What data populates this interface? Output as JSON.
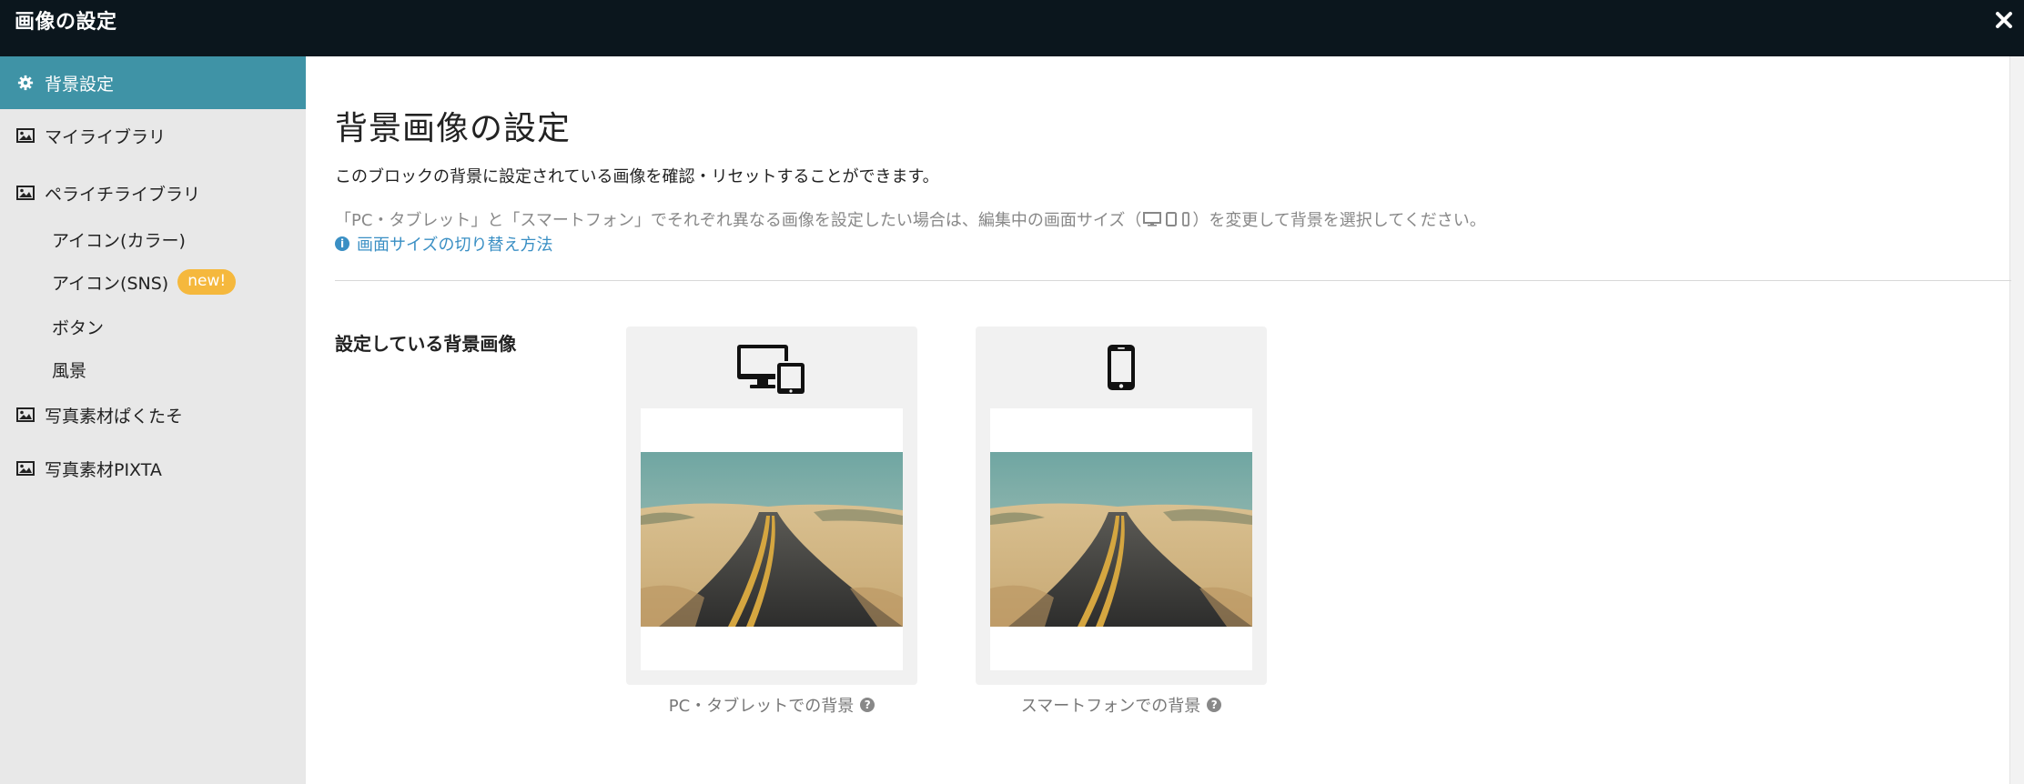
{
  "window": {
    "title": "画像の設定"
  },
  "sidebar": {
    "items": [
      {
        "label": "背景設定",
        "icon": "gear-icon",
        "active": true
      },
      {
        "label": "マイライブラリ",
        "icon": "image-icon"
      },
      {
        "label": "ペライチライブラリ",
        "icon": "image-icon"
      },
      {
        "label": "写真素材ぱくたそ",
        "icon": "image-icon"
      },
      {
        "label": "写真素材PIXTA",
        "icon": "image-icon"
      }
    ],
    "subitems": [
      {
        "label": "アイコン(カラー)"
      },
      {
        "label": "アイコン(SNS)",
        "badge": "new!"
      },
      {
        "label": "ボタン"
      },
      {
        "label": "風景"
      }
    ]
  },
  "main": {
    "heading": "背景画像の設定",
    "description": "このブロックの背景に設定されている画像を確認・リセットすることができます。",
    "note_before": "「PC・タブレット」と「スマートフォン」でそれぞれ異なる画像を設定したい場合は、編集中の画面サイズ（",
    "note_after": "）を変更して背景を選択してください。",
    "help_link": "画面サイズの切り替え方法",
    "section_label": "設定している背景画像",
    "cards": [
      {
        "caption": "PC・タブレットでの背景",
        "icon": "desktop-tablet-icon"
      },
      {
        "caption": "スマートフォンでの背景",
        "icon": "smartphone-icon"
      }
    ]
  },
  "colors": {
    "titlebar": "#0b161d",
    "sidebar_active": "#3f93a6",
    "badge": "#f5b83d",
    "link": "#3a8fc4"
  }
}
